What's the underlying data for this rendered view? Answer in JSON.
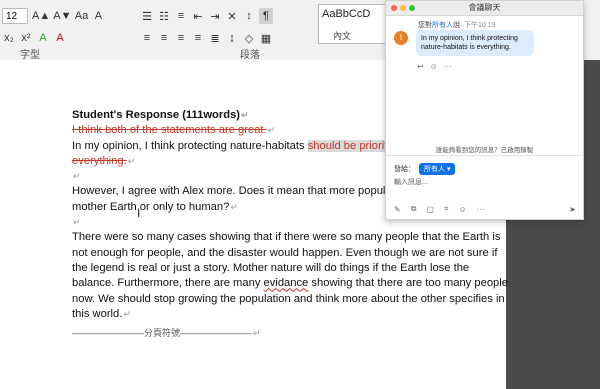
{
  "ribbon": {
    "font_size": "12",
    "font_group_label": "字型",
    "paragraph_group_label": "段落",
    "style_sample": "AaBbCcD",
    "style_name": "內文",
    "buttons": [
      "A▲",
      "A▼",
      "Aa",
      "A",
      "x₂",
      "x²",
      "A",
      "A"
    ]
  },
  "document": {
    "heading": "Student's Response (111words)",
    "deleted_line": "I think both of the statements are great.",
    "line2_pre": "In my opinion, I think protecting nature-habitats ",
    "line2_hl": "should be prioritized",
    "line2_del": "everything.",
    "para2": "However, I agree with Alex more. Does it mean that more population is necessary to our mother Earth or only to human?",
    "para3_a": "There were so many cases showing that if there were so many people that the Earth is not enough for people, and the disaster would happen. Even though we are not sure if the legend is real or just a story. Mother nature will do things if the Earth lose the balance. Furthermore, there are many ",
    "para3_err": "evidance",
    "para3_b": " showing that there are too many people now. We should stop growing the population and think more about the other specifies in this world.",
    "page_break": "分頁符號",
    "para_mark": "↵"
  },
  "chat": {
    "window_title": "會議聊天",
    "avatar_letter": "I",
    "sender_pre": "您對",
    "sender_target": "所有人",
    "sender_post": "說",
    "time": "下午10:19",
    "message": "In my opinion, I think protecting nature-habitats is everything.",
    "notice": "誰能夠看到您的訊息？已啟用錄製",
    "send_to_label": "發給：",
    "send_to_value": "所有人 ▾",
    "input_placeholder": "輸入訊息...",
    "colors": {
      "accent": "#0e71eb",
      "bubble": "#dcecfb",
      "avatar": "#e8802a"
    }
  }
}
